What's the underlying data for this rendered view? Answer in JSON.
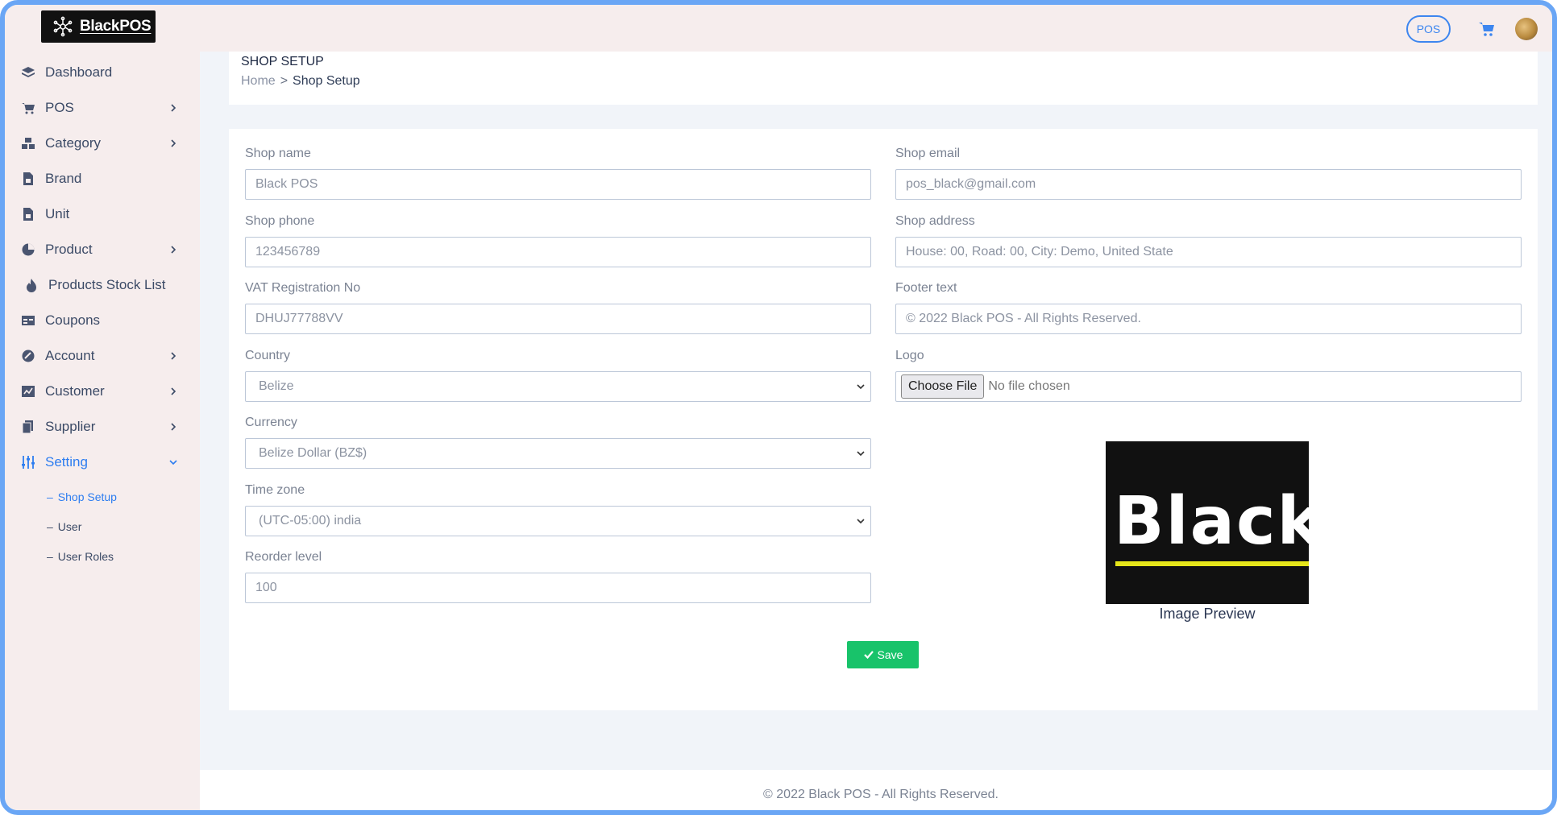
{
  "app": {
    "logo_text": "BlackPOS"
  },
  "topbar": {
    "pos_label": "POS"
  },
  "sidebar": {
    "items": [
      {
        "label": "Dashboard",
        "icon": "dashboard-icon",
        "has_chevron": false
      },
      {
        "label": "POS",
        "icon": "cart-icon",
        "has_chevron": true
      },
      {
        "label": "Category",
        "icon": "category-icon",
        "has_chevron": true
      },
      {
        "label": "Brand",
        "icon": "brand-icon",
        "has_chevron": false
      },
      {
        "label": "Unit",
        "icon": "unit-icon",
        "has_chevron": false
      },
      {
        "label": "Product",
        "icon": "product-icon",
        "has_chevron": true
      },
      {
        "label": "Products Stock List",
        "icon": "fire-icon",
        "has_chevron": false
      },
      {
        "label": "Coupons",
        "icon": "coupon-icon",
        "has_chevron": false
      },
      {
        "label": "Account",
        "icon": "account-icon",
        "has_chevron": true
      },
      {
        "label": "Customer",
        "icon": "customer-icon",
        "has_chevron": true
      },
      {
        "label": "Supplier",
        "icon": "supplier-icon",
        "has_chevron": true
      },
      {
        "label": "Setting",
        "icon": "sliders-icon",
        "has_chevron": true
      }
    ],
    "setting_sub": [
      {
        "label": "Shop Setup"
      },
      {
        "label": "User"
      },
      {
        "label": "User Roles"
      }
    ]
  },
  "page": {
    "title": "SHOP SETUP",
    "breadcrumb_home": "Home",
    "breadcrumb_current": "Shop Setup"
  },
  "form": {
    "shop_name_label": "Shop name",
    "shop_name_value": "Black POS",
    "shop_email_label": "Shop email",
    "shop_email_value": "pos_black@gmail.com",
    "shop_phone_label": "Shop phone",
    "shop_phone_value": "123456789",
    "shop_address_label": "Shop address",
    "shop_address_value": "House: 00, Road: 00, City: Demo, United State",
    "vat_label": "VAT Registration No",
    "vat_value": "DHUJ77788VV",
    "footer_text_label": "Footer text",
    "footer_text_value": "© 2022 Black POS - All Rights Reserved.",
    "country_label": "Country",
    "country_value": "Belize",
    "logo_label": "Logo",
    "choose_file_label": "Choose File",
    "no_file_text": "No file chosen",
    "currency_label": "Currency",
    "currency_value": "Belize Dollar (BZ$)",
    "timezone_label": "Time zone",
    "timezone_value": "(UTC-05:00) india",
    "reorder_label": "Reorder level",
    "reorder_value": "100",
    "preview_word": "Black",
    "preview_caption": "Image Preview",
    "save_label": "Save"
  },
  "footer": {
    "text": "© 2022 Black POS - All Rights Reserved."
  },
  "colors": {
    "accent": "#2d7df0",
    "save": "#18c36a",
    "sidebar_bg": "#f6eded"
  }
}
